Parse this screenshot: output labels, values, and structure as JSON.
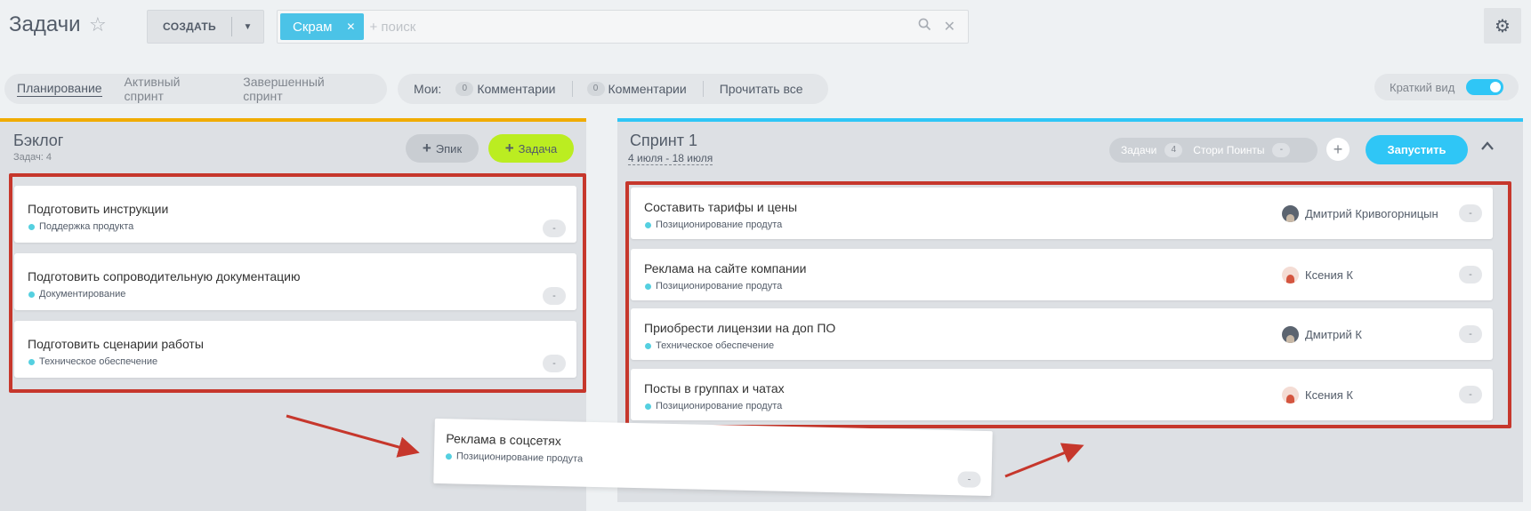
{
  "header": {
    "title": "Задачи",
    "create_label": "СОЗДАТЬ",
    "filter_chip": "Скрам",
    "search_placeholder": "+ поиск"
  },
  "tabs": {
    "items": [
      "Планирование",
      "Активный спринт",
      "Завершенный спринт"
    ],
    "active": "Планирование"
  },
  "counters": {
    "mine_label": "Мои:",
    "comments1_count": "0",
    "comments1_label": "Комментарии",
    "comments2_count": "0",
    "comments2_label": "Комментарии",
    "read_all": "Прочитать все"
  },
  "brief_view": {
    "label": "Краткий вид",
    "enabled": true
  },
  "backlog": {
    "title": "Бэклог",
    "subtitle": "Задач: 4",
    "epic_button": "Эпик",
    "task_button": "Задача",
    "tasks": [
      {
        "title": "Подготовить инструкции",
        "epic": "Поддержка продукта",
        "estimate": "-"
      },
      {
        "title": "Подготовить сопроводительную документацию",
        "epic": "Документирование",
        "estimate": "-"
      },
      {
        "title": "Подготовить сценарии работы",
        "epic": "Техническое обеспечение",
        "estimate": "-"
      }
    ]
  },
  "sprint": {
    "title": "Спринт 1",
    "dates": "4 июля - 18 июля",
    "tasks_label": "Задачи",
    "tasks_count": "4",
    "story_points_label": "Стори Поинты",
    "story_points_value": "-",
    "start_button": "Запустить",
    "tasks": [
      {
        "title": "Составить тарифы и цены",
        "epic": "Позиционирование продута",
        "assignee": "Дмитрий Кривогорницын",
        "estimate": "-"
      },
      {
        "title": "Реклама на сайте компании",
        "epic": "Позиционирование продута",
        "assignee": "Ксения К",
        "estimate": "-"
      },
      {
        "title": "Приобрести лицензии на доп ПО",
        "epic": "Техническое обеспечение",
        "assignee": "Дмитрий К",
        "estimate": "-"
      },
      {
        "title": "Посты в группах и чатах",
        "epic": "Позиционирование продута",
        "assignee": "Ксения К",
        "estimate": "-"
      }
    ]
  },
  "dragged_task": {
    "title": "Реклама в соцсетях",
    "epic": "Позиционирование продута",
    "estimate": "-"
  },
  "colors": {
    "accent_blue": "#2fc6f6",
    "accent_green": "#bbed21",
    "backlog_border": "#f0ac00",
    "highlight_red": "#c6372c",
    "epic_dot": "#55d0e0"
  }
}
